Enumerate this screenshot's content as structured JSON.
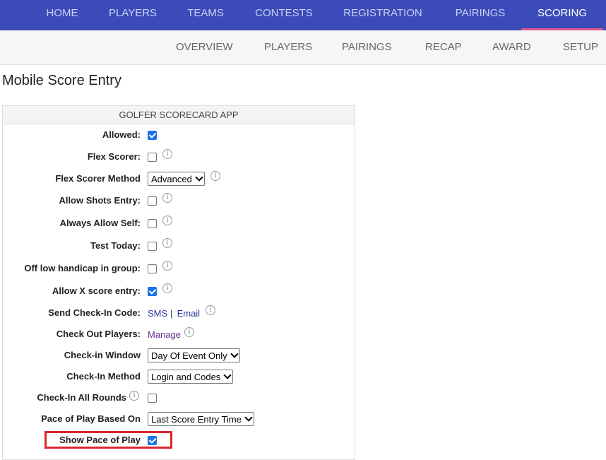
{
  "topnav": {
    "items": [
      "HOME",
      "PLAYERS",
      "TEAMS",
      "CONTESTS",
      "REGISTRATION",
      "PAIRINGS",
      "SCORING"
    ],
    "active": "SCORING",
    "accent": "#e0568a",
    "background": "#3b4cb8"
  },
  "subnav": {
    "items": [
      "OVERVIEW",
      "PLAYERS",
      "PAIRINGS",
      "RECAP",
      "AWARD",
      "SETUP"
    ]
  },
  "page": {
    "title": "Mobile Score Entry"
  },
  "panel": {
    "header": "GOLFER SCORECARD APP",
    "rows": {
      "allowed": {
        "label": "Allowed:",
        "checked": true
      },
      "flex_scorer": {
        "label": "Flex Scorer:",
        "checked": false
      },
      "flex_scorer_method": {
        "label": "Flex Scorer Method",
        "value": "Advanced"
      },
      "allow_shots_entry": {
        "label": "Allow Shots Entry:",
        "checked": false
      },
      "always_allow_self": {
        "label": "Always Allow Self:",
        "checked": false
      },
      "test_today": {
        "label": "Test Today:",
        "checked": false
      },
      "off_low_handicap": {
        "label": "Off low handicap in group:",
        "checked": false
      },
      "allow_x_score": {
        "label": "Allow X score entry:",
        "checked": true
      },
      "send_checkin_code": {
        "label": "Send Check-In Code:",
        "sms": "SMS",
        "separator": "|",
        "email": "Email"
      },
      "check_out_players": {
        "label": "Check Out Players:",
        "link": "Manage"
      },
      "checkin_window": {
        "label": "Check-in Window",
        "value": "Day Of Event Only"
      },
      "checkin_method": {
        "label": "Check-In Method",
        "value": "Login and Codes"
      },
      "checkin_all_rounds": {
        "label": "Check-In All Rounds",
        "checked": false
      },
      "pace_of_play_based_on": {
        "label": "Pace of Play Based On",
        "value": "Last Score Entry Time"
      },
      "show_pace_of_play": {
        "label": "Show Pace of Play",
        "checked": true
      }
    }
  },
  "icons": {
    "info": "info-icon",
    "info_glyph": "i",
    "dropdown": "chevron-down-icon"
  },
  "colors": {
    "checkbox_checked": "#1a73e8",
    "highlight": "#d9262c"
  }
}
